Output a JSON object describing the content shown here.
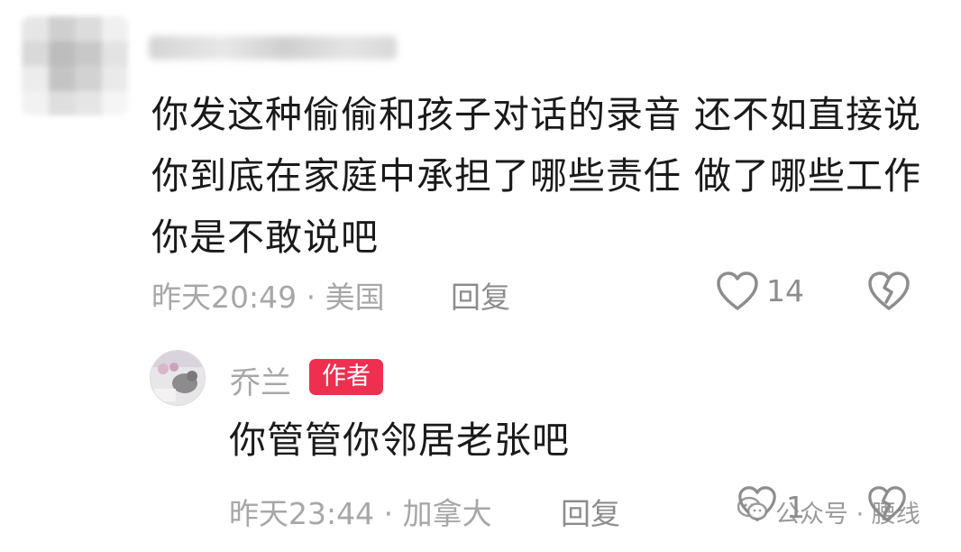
{
  "comment": {
    "text": "你发这种偷偷和孩子对话的录音 还不如直接说 你到底在家庭中承担了哪些责任 做了哪些工作 你是不敢说吧",
    "time_location": "昨天20:49 · 美国",
    "reply_label": "回复",
    "like_count": "14",
    "like_icon": "heart-outline-icon",
    "dislike_icon": "broken-heart-icon"
  },
  "reply": {
    "author_name": "乔兰",
    "author_badge": "作者",
    "text": "你管管你邻居老张吧",
    "time_location": "昨天23:44 · 加拿大",
    "reply_label": "回复",
    "like_count": "1",
    "like_icon": "heart-outline-icon",
    "dislike_icon": "broken-heart-icon"
  },
  "watermark": {
    "label": "公众号 · 腰线",
    "icon": "wechat-icon"
  },
  "colors": {
    "badge": "#ef2f4f",
    "meta": "#a7a7a7",
    "text": "#1a1a1a"
  }
}
